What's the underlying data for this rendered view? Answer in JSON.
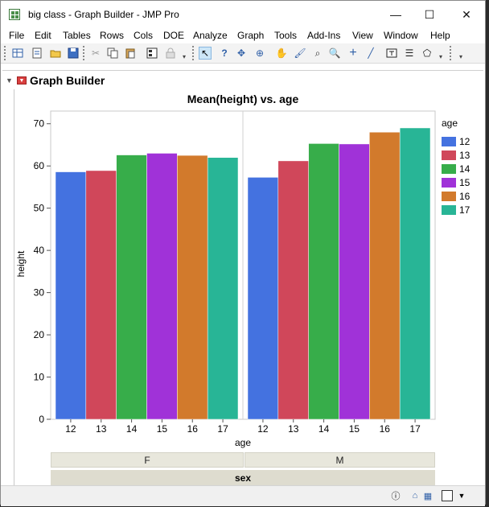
{
  "window": {
    "title": "big class - Graph Builder - JMP Pro",
    "controls": {
      "minimize": "—",
      "maximize": "☐",
      "close": "✕"
    }
  },
  "menu": [
    "File",
    "Edit",
    "Tables",
    "Rows",
    "Cols",
    "DOE",
    "Analyze",
    "Graph",
    "Tools",
    "Add-Ins",
    "View",
    "Window",
    "Help"
  ],
  "toolbar": {
    "icons": [
      "new-data-table-icon",
      "new-script-icon",
      "open-icon",
      "save-icon",
      "cut-icon",
      "copy-icon",
      "paste-icon",
      "data-table-icon",
      "lock-icon",
      "arrow-tool-icon",
      "help-tool-icon",
      "selection-tool-icon",
      "crosshair-tool-icon",
      "grabber-tool-icon",
      "brush-tool-icon",
      "lasso-tool-icon",
      "magnifier-tool-icon",
      "plus-tool-icon",
      "line-tool-icon",
      "annotate-tool-icon",
      "simple-shape-tool-icon",
      "polygon-tool-icon"
    ]
  },
  "outline": {
    "title": "Graph Builder"
  },
  "chart_data": {
    "type": "bar",
    "title": "Mean(height) vs. age",
    "xlabel": "age",
    "ylabel": "height",
    "ylim": [
      0,
      73
    ],
    "yticks": [
      0,
      10,
      20,
      30,
      40,
      50,
      60,
      70
    ],
    "categories": [
      "12",
      "13",
      "14",
      "15",
      "16",
      "17"
    ],
    "panels": [
      {
        "facet": "F",
        "values": [
          58.6,
          58.9,
          62.6,
          63.0,
          62.5,
          62.0
        ]
      },
      {
        "facet": "M",
        "values": [
          57.3,
          61.2,
          65.3,
          65.2,
          68.0,
          69.0
        ]
      }
    ],
    "facet_title": "sex",
    "legend": {
      "title": "age",
      "placement": "right"
    },
    "colors": [
      "#4472e0",
      "#d0475a",
      "#37ad4a",
      "#a032d8",
      "#d27a2c",
      "#28b596"
    ]
  },
  "status": {
    "info": "ⓘ",
    "home": "⌂",
    "table": "▦"
  }
}
